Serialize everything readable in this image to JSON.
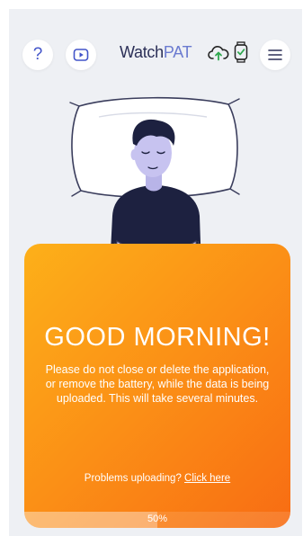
{
  "header": {
    "help_icon": "question-mark-icon",
    "video_icon": "play-video-icon",
    "logo_part1": "Watch",
    "logo_part2": "PAT",
    "upload_icon": "cloud-upload-icon",
    "device_icon": "watch-check-icon",
    "menu_icon": "hamburger-menu-icon"
  },
  "illustration": "sleeping-man-pillow-illustration",
  "card": {
    "title": "GOOD MORNING!",
    "message": "Please do not close or delete the application, or remove the battery, while the data is being uploaded. This will take several minutes.",
    "problems_text": "Problems uploading?",
    "problems_link": "Click here",
    "progress_label": "50%",
    "progress_fraction": 0.5
  },
  "colors": {
    "card_start": "#fdb019",
    "card_end": "#f86c13",
    "accent": "#4254c9",
    "background": "#eef0f4"
  }
}
